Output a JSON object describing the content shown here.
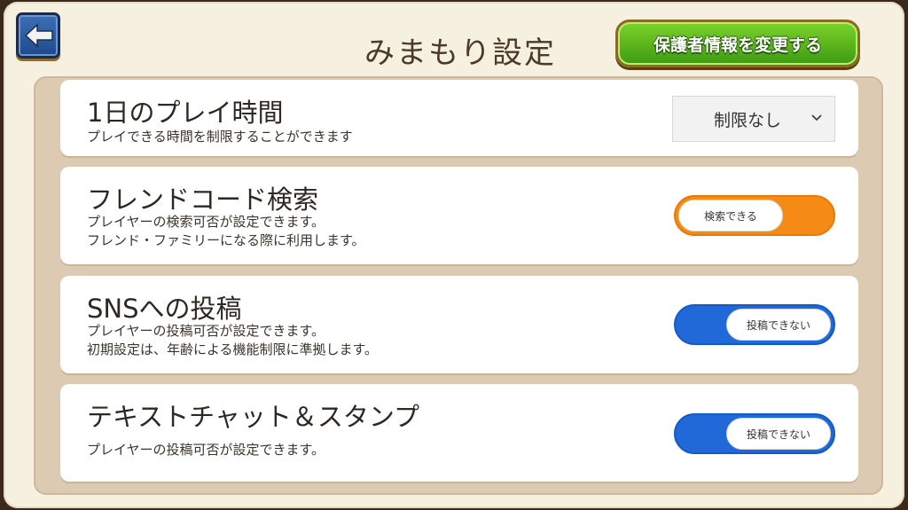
{
  "header": {
    "title": "みまもり設定",
    "guardian_button_label": "保護者情報を変更する",
    "back_icon": "back-arrow-icon"
  },
  "settings": [
    {
      "title": "1日のプレイ時間",
      "description": "プレイできる時間を制限することができます",
      "control": "select",
      "value": "制限なし"
    },
    {
      "title": "フレンドコード検索",
      "description": "プレイヤーの検索可否が設定できます。\nフレンド・ファミリーになる際に利用します。",
      "control": "toggle",
      "state": "on",
      "value": "検索できる"
    },
    {
      "title": "SNSへの投稿",
      "description": "プレイヤーの投稿可否が設定できます。\n初期設定は、年齢による機能制限に準拠します。",
      "control": "toggle",
      "state": "off",
      "value": "投稿できない"
    },
    {
      "title": "テキストチャット＆スタンプ",
      "description": "プレイヤーの投稿可否が設定できます。",
      "control": "toggle",
      "state": "off",
      "value": "投稿できない"
    }
  ],
  "colors": {
    "toggle_on": "#f58a14",
    "toggle_off": "#2168d8",
    "guardian_button": "#5fb81e",
    "back_button": "#2f5fa8"
  }
}
